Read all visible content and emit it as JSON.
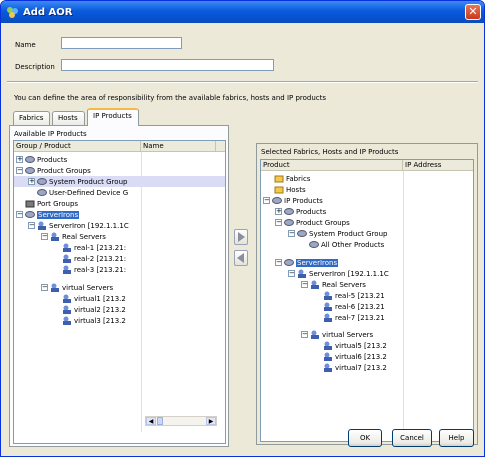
{
  "window": {
    "title": "Add AOR"
  },
  "form": {
    "name_label": "Name",
    "name_value": "",
    "description_label": "Description",
    "description_value": ""
  },
  "info_text": "You can define the area of responsibility from the available fabrics, hosts and IP products",
  "tabs": [
    {
      "label": "Fabrics"
    },
    {
      "label": "Hosts"
    },
    {
      "label": "IP Products"
    }
  ],
  "available": {
    "header": "Available IP Products",
    "col_group": "Group / Product",
    "col_name": "Name",
    "rows": [
      "Products",
      "Product Groups",
      "System Product Group",
      "User-Defined Device G",
      "Port Groups",
      "ServerIrons",
      "ServerIron [192.1.1.1C",
      "Real Servers",
      "real-1 [213.21:",
      "real-2 [213.21:",
      "real-3 [213.21:",
      "virtual Servers",
      "virtual1 [213.2",
      "virtual2 [213.2",
      "virtual3 [213.2"
    ]
  },
  "selected": {
    "header": "Selected Fabrics, Hosts and IP Products",
    "col_product": "Product",
    "col_ip": "IP Address",
    "rows": [
      "Fabrics",
      "Hosts",
      "IP Products",
      "Products",
      "Product Groups",
      "System Product Group",
      "All Other Products",
      "ServerIrons",
      "ServerIron [192.1.1.1C",
      "Real Servers",
      "real-5 [213.21",
      "real-6 [213.21",
      "real-7 [213.21",
      "virtual Servers",
      "virtual5 [213.2",
      "virtual6 [213.2",
      "virtual7 [213.2"
    ]
  },
  "buttons": {
    "ok": "OK",
    "cancel": "Cancel",
    "help": "Help"
  },
  "icons": {
    "app": "network-icon",
    "close": "close-icon",
    "folder": "folder-icon",
    "product": "product-icon",
    "server": "server-icon",
    "user": "user-icon"
  }
}
